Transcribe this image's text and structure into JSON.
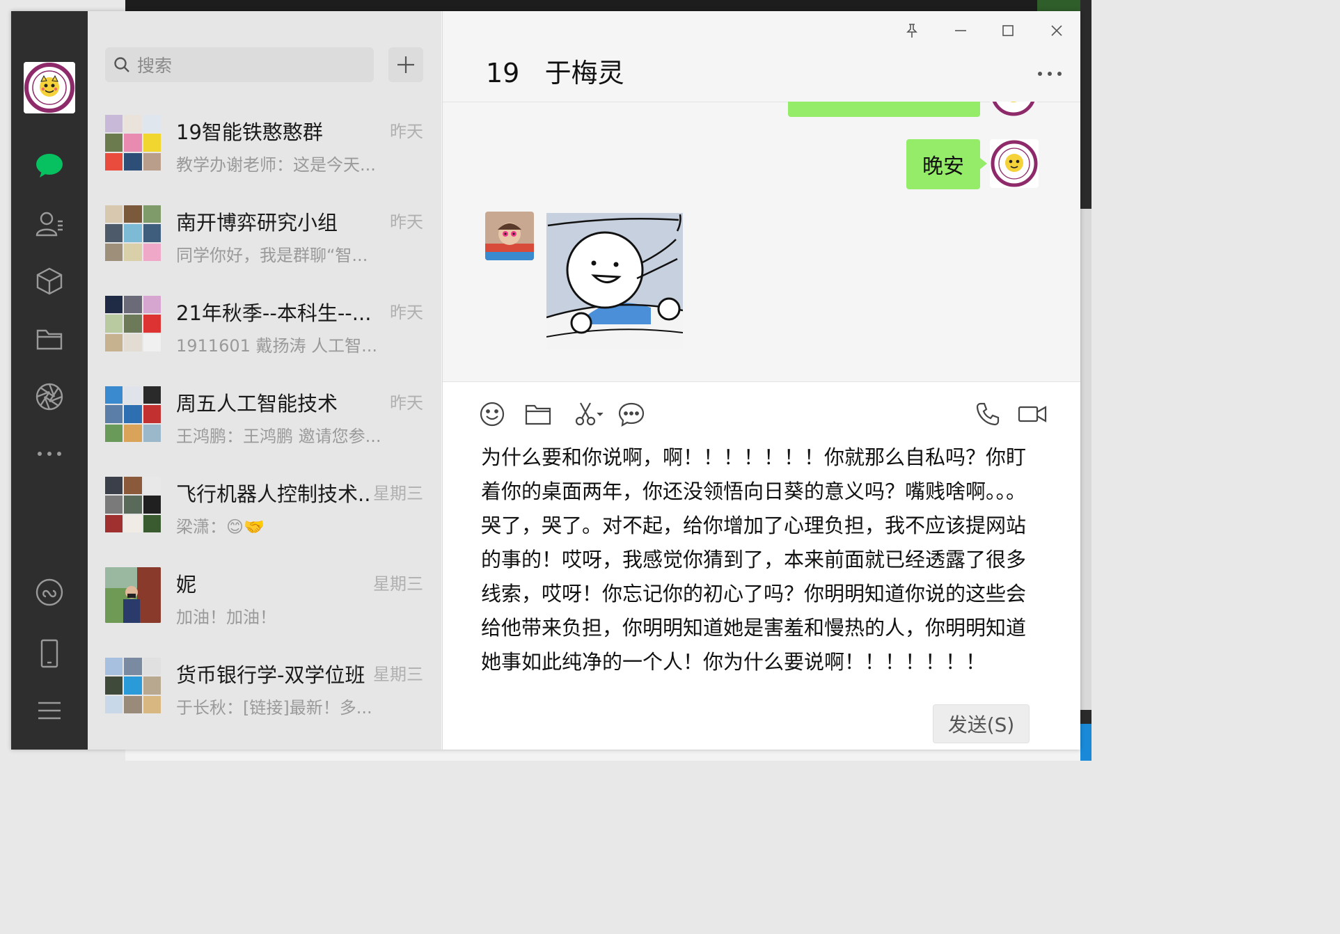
{
  "search": {
    "placeholder": "搜索"
  },
  "chats": [
    {
      "name": "19智能铁憨憨群",
      "time": "昨天",
      "preview": "教学办谢老师：这是今天..."
    },
    {
      "name": "南开博弈研究小组",
      "time": "昨天",
      "preview": "同学你好，我是群聊“智..."
    },
    {
      "name": "21年秋季--本科生--...",
      "time": "昨天",
      "preview": "1911601 戴扬涛 人工智..."
    },
    {
      "name": "周五人工智能技术",
      "time": "昨天",
      "preview": "王鸿鹏：王鸿鹏 邀请您参..."
    },
    {
      "name": "飞行机器人控制技术...",
      "time": "星期三",
      "preview": "梁潇：😊🤝"
    },
    {
      "name": "妮",
      "time": "星期三",
      "preview": "加油！加油！"
    },
    {
      "name": "货币银行学-双学位班",
      "time": "星期三",
      "preview": "于长秋：[链接]最新！多..."
    }
  ],
  "conversation": {
    "title": "19   于梅灵",
    "messages": [
      {
        "from": "me",
        "text": "晚安"
      }
    ]
  },
  "composer": {
    "text": "为什么要和你说啊，啊！！！！！！！你就那么自私吗？你盯着你的桌面两年，你还没领悟向日葵的意义吗？嘴贱啥啊。。。哭了，哭了。对不起，给你增加了心理负担，我不应该提网站的事的！哎呀，我感觉你猜到了，本来前面就已经透露了很多线索，哎呀！你忘记你的初心了吗？你明明知道你说的这些会给他带来负担，你明明知道她是害羞和慢热的人，你明明知道她事如此纯净的一个人！你为什么要说啊！！！！！！！",
    "send_label": "发送(S)"
  },
  "icons": {
    "nav": [
      "chat-icon",
      "contacts-icon",
      "favorites-icon",
      "files-icon",
      "moments-icon",
      "more-icon",
      "mini-program-icon",
      "phone-icon",
      "menu-icon"
    ],
    "toolbar": [
      "emoji-icon",
      "folder-icon",
      "scissors-icon",
      "chat-history-icon",
      "voice-call-icon",
      "video-call-icon"
    ]
  },
  "colors": {
    "accent": "#07c160",
    "bubble": "#95ec69",
    "sidebar": "#2e2e2e"
  }
}
